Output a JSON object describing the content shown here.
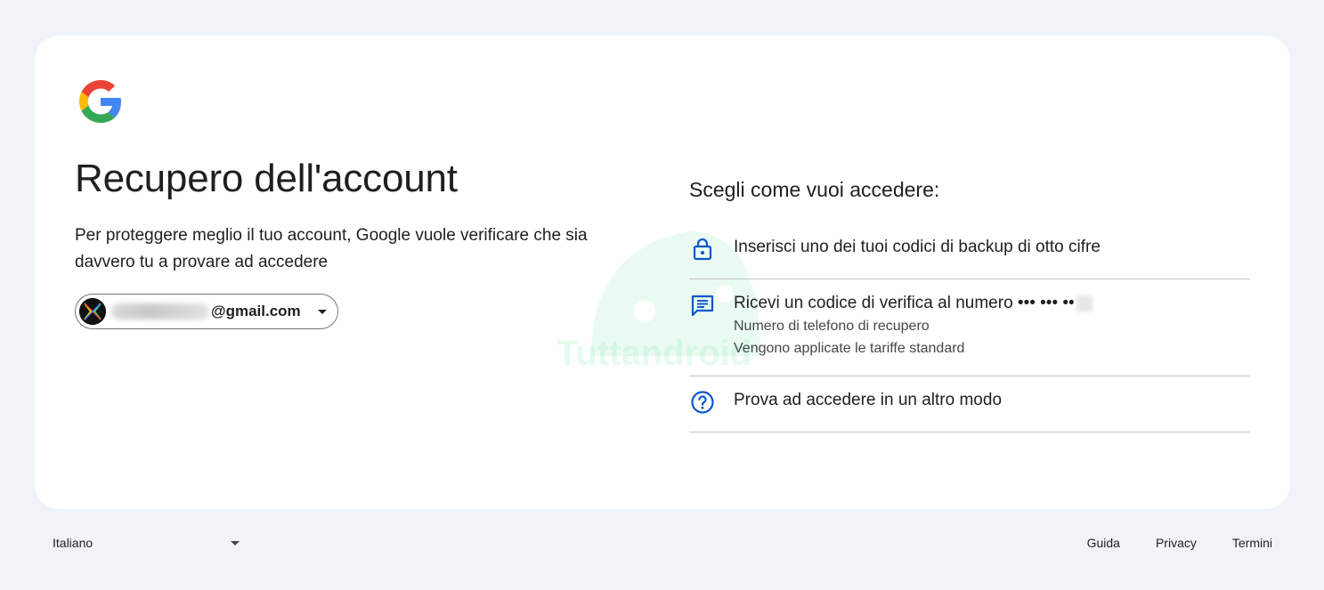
{
  "brand": {
    "logo": "google-g-logo",
    "colors": {
      "blue": "#4285F4",
      "red": "#EA4335",
      "yellow": "#FBBC05",
      "green": "#34A853",
      "accent": "#0b57d0"
    }
  },
  "main": {
    "title": "Recupero dell'account",
    "subtitle": "Per proteggere meglio il tuo account, Google vuole verificare che sia davvero tu a provare ad accedere",
    "account": {
      "email_suffix": "@gmail.com",
      "avatar_icon": "avatar-icon",
      "dropdown_icon": "chevron-down-icon"
    }
  },
  "recovery": {
    "heading": "Scegli come vuoi accedere:",
    "options": [
      {
        "icon": "lock-icon",
        "label": "Inserisci uno dei tuoi codici di backup di otto cifre"
      },
      {
        "icon": "message-icon",
        "label": "Ricevi un codice di verifica al numero ••• ••• ••",
        "sub1": "Numero di telefono di recupero",
        "sub2": "Vengono applicate le tariffe standard"
      },
      {
        "icon": "help-icon",
        "label": "Prova ad accedere in un altro modo"
      }
    ]
  },
  "footer": {
    "language": "Italiano",
    "links": [
      "Guida",
      "Privacy",
      "Termini"
    ]
  },
  "watermark": {
    "text": "Tuttandroid"
  }
}
